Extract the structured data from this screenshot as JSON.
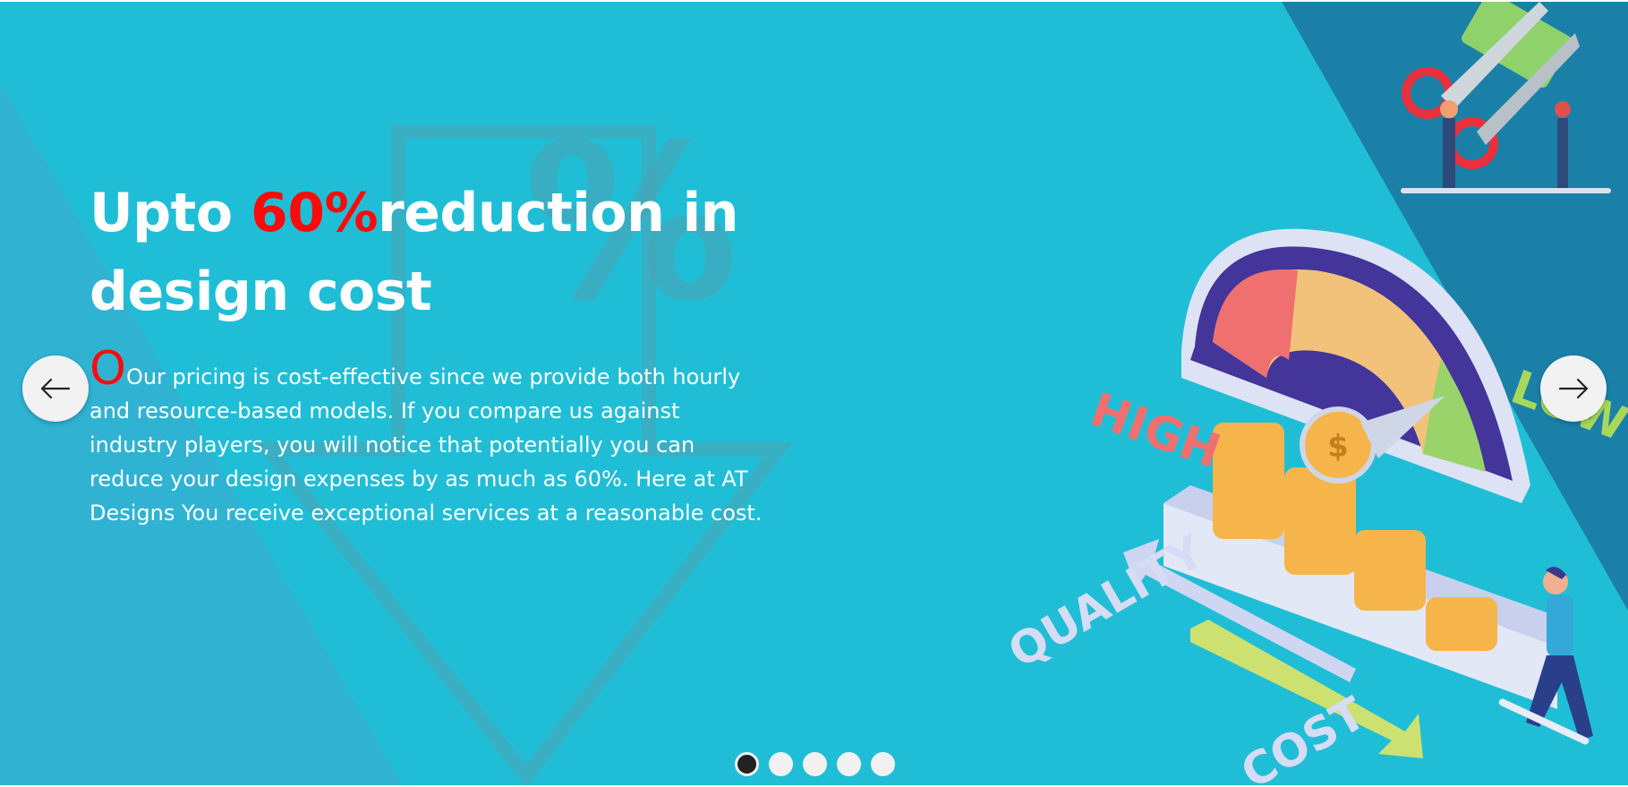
{
  "hero": {
    "headline_prefix": "Upto ",
    "headline_accent": "60%",
    "headline_suffix": "reduction in design cost",
    "dropcap": "O",
    "body": "Our pricing is cost-effective since we provide both hourly and resource-based models. If you compare us against industry players, you will notice that potentially you can reduce your design expenses by as much as 60%. Here at AT Designs You receive exceptional services at a reasonable cost."
  },
  "illustration": {
    "gauge_high": "HIGH",
    "gauge_low": "LOW",
    "quality_label": "QUALITY",
    "cost_label": "COST",
    "coin_symbol": "$"
  },
  "watermark": {
    "symbol": "%"
  },
  "carousel": {
    "slide_count": 5,
    "active_index": 0
  },
  "colors": {
    "background": "#20bed6",
    "accent": "#ff0a0a",
    "text": "#ffffff"
  },
  "icons": {
    "prev": "arrow-left-icon",
    "next": "arrow-right-icon"
  }
}
